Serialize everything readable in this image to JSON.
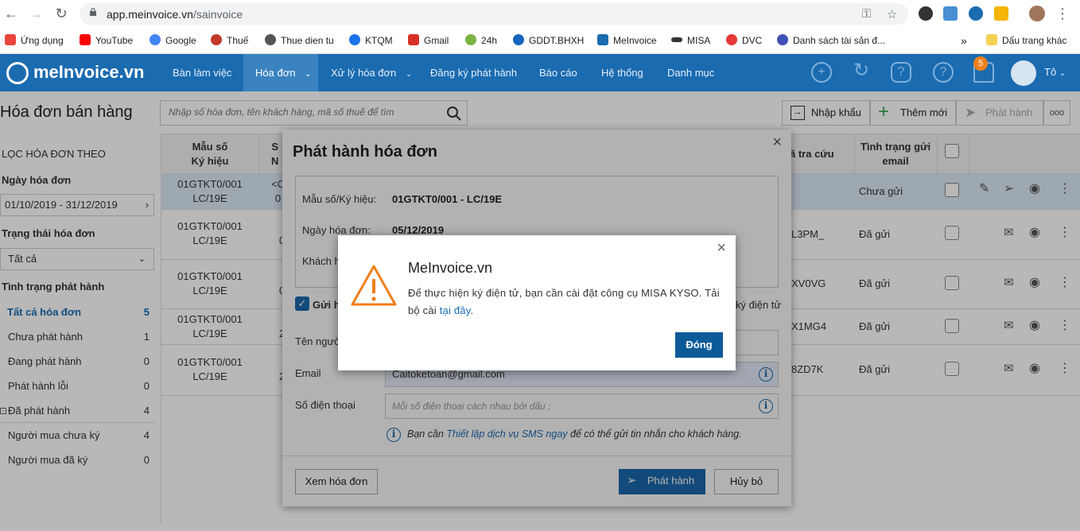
{
  "browser": {
    "url_host": "app.meinvoice.vn",
    "url_path": "/sainvoice",
    "bookmarks": [
      {
        "label": "Ứng dụng",
        "color": "#d93025"
      },
      {
        "label": "YouTube",
        "color": "#ff0000"
      },
      {
        "label": "Google",
        "color": "#4285f4"
      },
      {
        "label": "Thuế",
        "color": "#c0392b"
      },
      {
        "label": "Thue dien tu",
        "color": "#555555"
      },
      {
        "label": "KTQM",
        "color": "#1a73e8"
      },
      {
        "label": "Gmail",
        "color": "#d93025"
      },
      {
        "label": "24h",
        "color": "#7cb342"
      },
      {
        "label": "GDDT.BHXH",
        "color": "#1565c0"
      },
      {
        "label": "MeInvoice",
        "color": "#1a6bb0"
      },
      {
        "label": "MISA",
        "color": "#333333"
      },
      {
        "label": "DVC",
        "color": "#e53935"
      },
      {
        "label": "Danh sách tài sản đ...",
        "color": "#3f51b5"
      }
    ],
    "more_bookmarks": "»",
    "other_bookmarks": "Dấu trang khác"
  },
  "header": {
    "logo_text": "meInvoice.vn",
    "menu": [
      "Bàn làm việc",
      "Hóa đơn",
      "Xử lý hóa đơn",
      "Đăng ký phát hành",
      "Báo cáo",
      "Hệ thống",
      "Danh mục"
    ],
    "notification_count": "5",
    "user_name": "Tô"
  },
  "page": {
    "title": "Hóa đơn bán hàng",
    "search_placeholder": "Nhập số hóa đơn, tên khách hàng, mã số thuế để tìm",
    "import_label": "Nhập khẩu",
    "add_label": "Thêm mới",
    "publish_label": "Phát hành",
    "more_label": "ooo"
  },
  "filter": {
    "heading": "LỌC HÓA ĐƠN THEO",
    "date_label": "Ngày hóa đơn",
    "date_value": "01/10/2019 - 31/12/2019",
    "status_label": "Trạng thái hóa đơn",
    "status_value": "Tất cả",
    "publish_status_label": "Tình trạng phát hành",
    "items": [
      {
        "label": "Tất cả hóa đơn",
        "count": "5"
      },
      {
        "label": "Chưa phát hành",
        "count": "1"
      },
      {
        "label": "Đang phát hành",
        "count": "0"
      },
      {
        "label": "Phát hành lỗi",
        "count": "0"
      },
      {
        "label": "Đã phát hành",
        "count": "4"
      },
      {
        "label": "Người mua chưa ký",
        "count": "4"
      },
      {
        "label": "Người mua đã ký",
        "count": "0"
      }
    ]
  },
  "grid": {
    "col_template": "Mẫu số\nKý hiệu",
    "col_second_frag": "S\nN",
    "col_lookup": "ã tra cứu",
    "col_email_status": "Tình trạng gửi\nemail",
    "rows": [
      {
        "template": "01GTKT0/001\nLC/19E",
        "num": "<C\n0",
        "lookup": "",
        "status": "Chưa gửi"
      },
      {
        "template": "01GTKT0/001\nLC/19E",
        "num": "0",
        "lookup": "L3PM_",
        "status": "Đã gửi"
      },
      {
        "template": "01GTKT0/001\nLC/19E",
        "num": "0",
        "lookup": "XV0VG",
        "status": "Đã gửi"
      },
      {
        "template": "01GTKT0/001\nLC/19E",
        "num": "2",
        "lookup": "X1MG4",
        "status": "Đã gửi"
      },
      {
        "template": "01GTKT0/001\nLC/19E",
        "num": "2",
        "lookup": "8ZD7K",
        "status": "Đã gửi"
      }
    ]
  },
  "dialog": {
    "title": "Phát hành hóa đơn",
    "template_label": "Mẫu số/Ký hiệu:",
    "template_value": "01GTKT0/001 - LC/19E",
    "date_label": "Ngày hóa đơn:",
    "date_value": "05/12/2019",
    "customer_label_frag": "Khách h",
    "send_checkbox_frag": "Gửi h",
    "sign_frag": "ký điện tử",
    "recipient_label_frag": "Tên người",
    "email_label": "Email",
    "email_value": "Caitoketoan@gmail.com",
    "phone_label": "Số điện thoại",
    "phone_placeholder": "Mỗi số điện thoại cách nhau bởi dấu ;",
    "sms_prefix": "Bạn cần",
    "sms_link": "Thiết lập dịch vụ SMS ngay",
    "sms_suffix": "để có thể gửi tin nhắn cho khách hàng.",
    "view_button": "Xem hóa đơn",
    "publish_button": "Phát hành",
    "cancel_button": "Hủy bỏ"
  },
  "alert": {
    "title": "MeInvoice.vn",
    "message": "Để thực hiện ký điện tử, bạn cần cài đặt công cụ MISA KYSO. Tải bộ cài",
    "link": "tại đây",
    "period": ".",
    "ok_button": "Đóng"
  },
  "colors": {
    "brand": "#1a6bb0",
    "warning": "#f07f1a",
    "ok_button": "#0d5a99"
  }
}
